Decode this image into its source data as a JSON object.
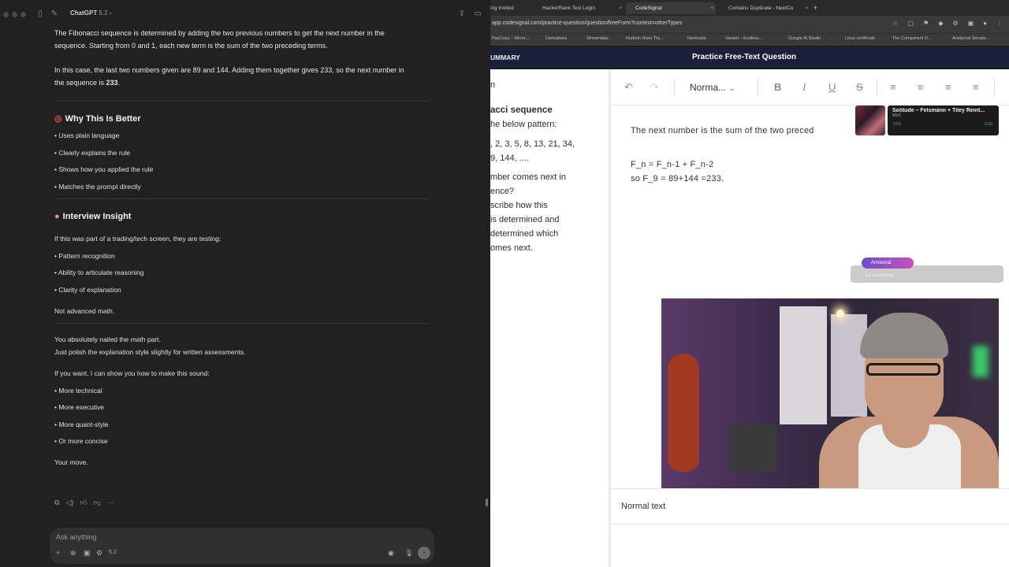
{
  "chat": {
    "app_title": "ChatGPT",
    "app_version": "5.2",
    "intro_p1": "The Fibonacci sequence is determined by adding the two previous numbers to get the next number in the",
    "intro_p1b": "sequence. Starting from 0 and 1, each new term is the sum of the two preceding terms.",
    "intro_p2a": "In this case, the last two numbers given are 89 and 144. Adding them together gives 233, so the next number in",
    "intro_p2b_prefix": "the sequence is ",
    "intro_p2b_bold": "233",
    "intro_p2b_suffix": ".",
    "why_heading": "Why This Is Better",
    "why_items": [
      "• Uses plain language",
      "• Clearly explains the rule",
      "• Shows how you applied the rule",
      "• Matches the prompt directly"
    ],
    "insight_heading": "Interview Insight",
    "insight_intro": "If this was part of a trading/tech screen, they are testing:",
    "insight_items": [
      "• Pattern recognition",
      "• Ability to articulate reasoning",
      "• Clarity of explanation"
    ],
    "not_advanced": "Not advanced math.",
    "closing_1": "You absolutely nailed the math part.",
    "closing_2": "Just polish the explanation style slightly for written assessments.",
    "offer": "If you want, I can show you how to make this sound:",
    "offer_items": [
      "• More technical",
      "• More executive",
      "• More quant-style",
      "• Or more concise"
    ],
    "your_move": "Your move.",
    "composer_placeholder": "Ask anything",
    "composer_version": "5.2"
  },
  "browser": {
    "tabs": [
      "ing Invited",
      "HackerRank Test Login",
      "CodeSignal",
      "Contains Duplicate - NeetCo"
    ],
    "url": "app.codesignal.com/practice-question/question/freeForm?context=otherTypes",
    "bookmarks": [
      "PayCopy – Mirror...",
      "Derivatives",
      "Streamlabs",
      "Hudson River Tra...",
      "Neetcode",
      "Variant – Endless...",
      "Google AI Studio",
      "Linux certificate",
      "The Component D...",
      "Aristocrat Stream..."
    ],
    "header_left": "UMMARY",
    "header_title": "Practice Free-Text Question"
  },
  "question": {
    "lines": [
      "n",
      "acci sequence",
      "he below pattern:",
      ", 2, 3, 5, 8, 13, 21, 34,",
      "9, 144, ....",
      "mber comes next in",
      "ence?",
      "scribe how this",
      " is determined and",
      "determined which",
      "omes next."
    ]
  },
  "editor": {
    "format_value": "Norma...",
    "line1": "The next number is the sum of the two preced",
    "line2": "F_n = F_n-1 + F_n-2",
    "line3": "so F_9 = 89+144 =233.",
    "footer_label": "Normal text"
  },
  "overlays": {
    "song_title": "Solitude – Felsmann + Tiley Reint...",
    "song_sub": "MSS",
    "time_elapsed": "0:00",
    "time_remaining": "-2:43",
    "aristocrat_label": "Aristocrat",
    "aristocrat_prompt": "Ask me anything"
  },
  "colors": {
    "chat_bg": "#212121",
    "cs_header": "#1a1f3c",
    "editor_bg": "#ffffff"
  }
}
